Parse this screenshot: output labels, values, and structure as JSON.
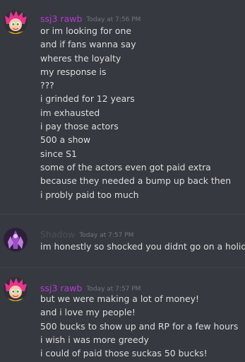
{
  "messages": [
    {
      "author": "ssj3 rawb",
      "author_color": "#b33cd6",
      "timestamp": "Today at 7:56 PM",
      "lines": [
        "or im looking for one",
        "and if fans wanna say",
        "wheres the loyalty",
        "my response is",
        "???",
        "i grinded for 12 years",
        "im exhausted",
        "i pay those actors",
        "500 a show",
        "since S1",
        "some of the actors even got paid extra",
        "because they needed a bump up back then",
        "i probly paid too much"
      ]
    },
    {
      "author": "Shadow",
      "author_color": "#4e5058",
      "timestamp": "Today at 7:57 PM",
      "lines": [
        "im honestly so shocked you didnt go on a holiday s"
      ]
    },
    {
      "author": "ssj3 rawb",
      "author_color": "#b33cd6",
      "timestamp": "Today at 7:57 PM",
      "lines": [
        "but we were making a lot of money!",
        "and i love my people!",
        "500 bucks to show up and RP for a few hours",
        "i wish i was more greedy",
        "i could of paid those suckas 50 bucks!"
      ]
    }
  ]
}
